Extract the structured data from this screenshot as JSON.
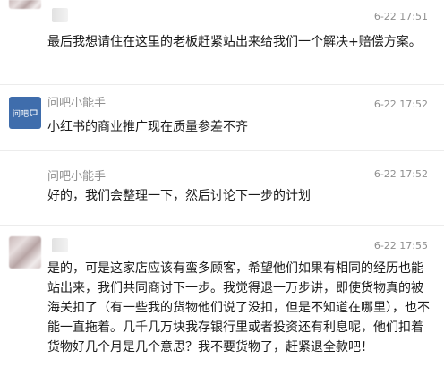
{
  "messages": [
    {
      "sender": "",
      "time": "6-22 17:51",
      "text": "最后我想请住在这里的老板赶紧站出来给我们一个解决+赔偿方案。"
    },
    {
      "sender": "问吧小能手",
      "avatar_logo_text": "问吧",
      "time": "6-22 17:52",
      "text": "小红书的商业推广现在质量参差不齐"
    },
    {
      "sender": "问吧小能手",
      "time": "6-22 17:52",
      "text": "好的，我们会整理一下，然后讨论下一步的计划"
    },
    {
      "sender": "",
      "time": "6-22 17:55",
      "text": "是的，可是这家店应该有蛮多顾客，希望他们如果有相同的经历也能站出来，我们共同商讨下一步。我觉得退一万步讲，即使货物真的被海关扣了（有一些我的货物他们说了没扣，但是不知道在哪里），也不能一直拖着。几千几万块我存银行里或者投资还有利息呢，他们扣着货物好几个月是几个意思？我不要货物了，赶紧退全款吧！"
    }
  ],
  "colors": {
    "meta_text": "#8f8f8f",
    "body_text": "#1a1a1a",
    "logo_bg": "#3f6dac",
    "divider": "#ececec"
  }
}
